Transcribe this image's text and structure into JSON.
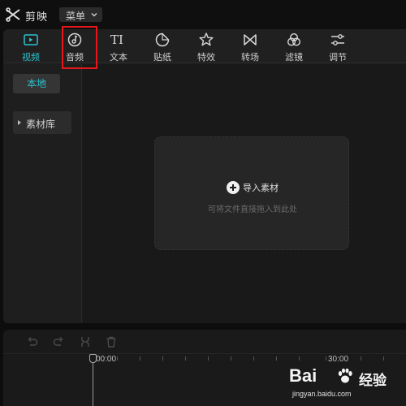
{
  "titlebar": {
    "app_name": "剪映",
    "menu_label": "菜单"
  },
  "toolbar": {
    "items": [
      {
        "label": "视频",
        "icon": "video-icon",
        "active": true
      },
      {
        "label": "音频",
        "icon": "audio-icon",
        "active": false
      },
      {
        "label": "文本",
        "icon": "text-icon",
        "active": false
      },
      {
        "label": "贴纸",
        "icon": "sticker-icon",
        "active": false
      },
      {
        "label": "特效",
        "icon": "effects-icon",
        "active": false
      },
      {
        "label": "转场",
        "icon": "transition-icon",
        "active": false
      },
      {
        "label": "滤镜",
        "icon": "filter-icon",
        "active": false
      },
      {
        "label": "调节",
        "icon": "adjust-icon",
        "active": false
      }
    ],
    "highlighted": "音频"
  },
  "sidebar": {
    "local": "本地",
    "library": "素材库"
  },
  "main": {
    "import_label": "导入素材",
    "hint": "可将文件直接拖入到此处"
  },
  "timeline": {
    "time_start": "00:00",
    "time_30": "30:00"
  },
  "watermark": {
    "brand": "Bai",
    "brand2": "经验",
    "url": "jingyan.baidu.com"
  },
  "colors": {
    "accent": "#28c4cf",
    "highlight": "#e8161b",
    "background": "#0d0d0d"
  }
}
